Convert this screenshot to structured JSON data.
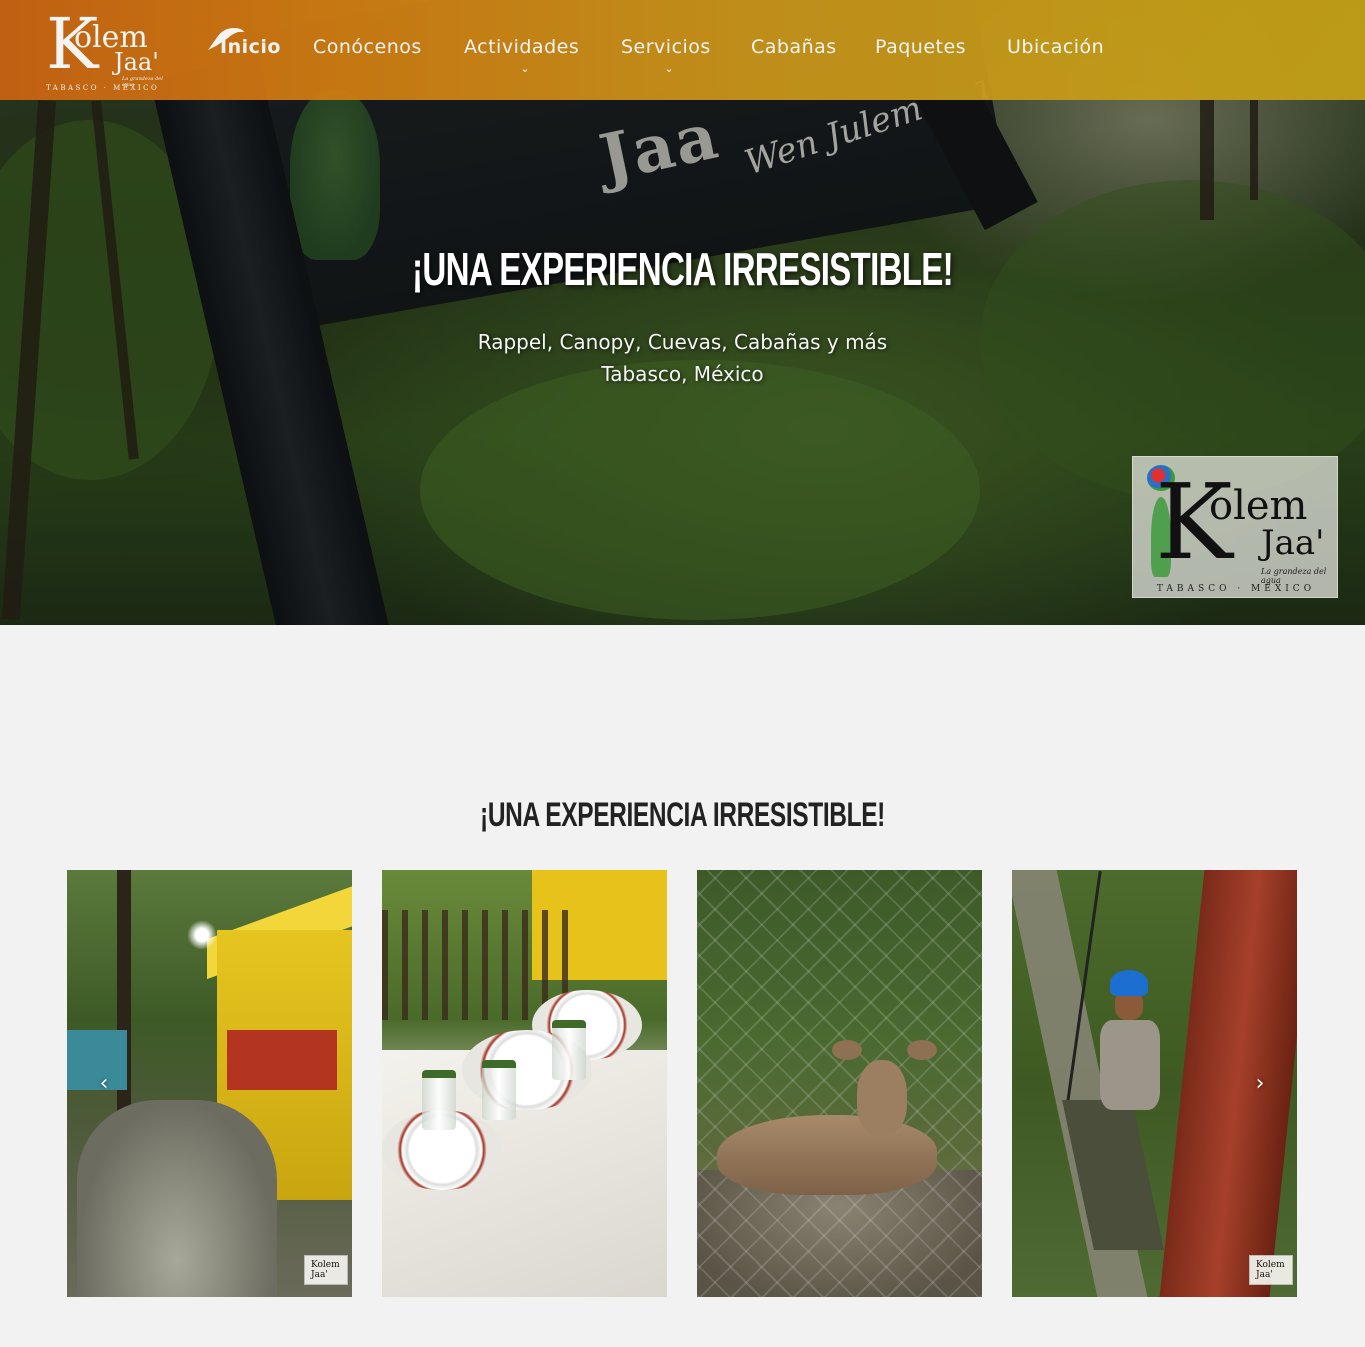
{
  "brand": {
    "logo_main": "K",
    "logo_olem": "olem",
    "logo_jaa": "Jaa'",
    "logo_tagline": "La grandeza del agua",
    "logo_location": "TABASCO · MÉXICO",
    "colors": {
      "header_start": "#c96312",
      "header_end": "#c2a016",
      "page_bg": "#f2f2f2"
    }
  },
  "nav": {
    "items": [
      {
        "label": "Inicio",
        "active": true,
        "icon": "bird-icon"
      },
      {
        "label": "Conócenos"
      },
      {
        "label": "Actividades",
        "has_dropdown": true
      },
      {
        "label": "Servicios",
        "has_dropdown": true
      },
      {
        "label": "Cabañas"
      },
      {
        "label": "Paquetes"
      },
      {
        "label": "Ubicación"
      }
    ],
    "caret": "⌄"
  },
  "hero": {
    "title": "¡UNA EXPERIENCIA IRRESISTIBLE!",
    "subtitle_line1": "Rappel, Canopy, Cuevas, Cabañas y más",
    "subtitle_line2": "Tabasco, México",
    "badge": {
      "main": "K",
      "olem": "olem",
      "jaa": "Jaa'",
      "tagline": "La grandeza del agua",
      "location": "TABASCO · MÉXICO"
    }
  },
  "section": {
    "title": "¡UNA EXPERIENCIA IRRESISTIBLE!"
  },
  "carousel": {
    "prev_icon": "‹",
    "next_icon": "›",
    "slides": [
      {
        "subject": "cabin-path",
        "watermark": "Kolem Jaa'"
      },
      {
        "subject": "dining-table"
      },
      {
        "subject": "deer"
      },
      {
        "subject": "canopy-climber",
        "watermark": "Kolem Jaa'"
      }
    ]
  }
}
